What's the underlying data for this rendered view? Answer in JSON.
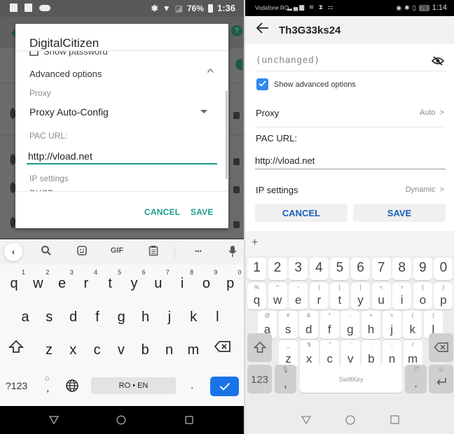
{
  "left": {
    "status_bar": {
      "battery": "76%",
      "time": "1:36",
      "left_icons": [
        "notes-icon",
        "image-icon",
        "cloud-icon"
      ],
      "right_icons": [
        "bluetooth-icon",
        "wifi-icon",
        "no-sim-icon",
        "battery-charging-icon"
      ]
    },
    "dialog": {
      "title": "DigitalCitizen",
      "show_password_label": "Show password",
      "show_password_checked": false,
      "advanced_options_label": "Advanced options",
      "proxy_label": "Proxy",
      "proxy_value": "Proxy Auto-Config",
      "pac_url_label": "PAC URL:",
      "pac_url_value": "http://vload.net",
      "ip_settings_label": "IP settings",
      "ip_settings_value_cut": "DHCP",
      "cancel_label": "CANCEL",
      "save_label": "SAVE",
      "accent_color": "#1a9e8a"
    },
    "keyboard": {
      "toolbar": {
        "back": "‹",
        "gif": "GIF",
        "more": "•••"
      },
      "row1": [
        {
          "k": "q",
          "n": "1"
        },
        {
          "k": "w",
          "n": "2"
        },
        {
          "k": "e",
          "n": "3"
        },
        {
          "k": "r",
          "n": "4"
        },
        {
          "k": "t",
          "n": "5"
        },
        {
          "k": "y",
          "n": "6"
        },
        {
          "k": "u",
          "n": "7"
        },
        {
          "k": "i",
          "n": "8"
        },
        {
          "k": "o",
          "n": "9"
        },
        {
          "k": "p",
          "n": "0"
        }
      ],
      "row2": [
        "a",
        "s",
        "d",
        "f",
        "g",
        "h",
        "j",
        "k",
        "l"
      ],
      "row3": [
        "z",
        "x",
        "c",
        "v",
        "b",
        "n",
        "m"
      ],
      "symbols_label": "?123",
      "comma_label": ",",
      "space_label": "RO • EN",
      "period_label": ".",
      "enter_color": "#1a73e8"
    }
  },
  "right": {
    "status_bar": {
      "carrier": "Vodafone RO",
      "battery": "79",
      "time": "1:14"
    },
    "app_bar": {
      "title": "Th3G33ks24"
    },
    "password_value": "(unchanged)",
    "show_advanced_label": "Show advanced options",
    "show_advanced_checked": true,
    "proxy_label": "Proxy",
    "proxy_value": "Auto",
    "pac_url_label": "PAC URL:",
    "pac_url_value": "http://vload.net",
    "ip_settings_label": "IP settings",
    "ip_settings_value": "Dynamic",
    "cancel_label": "CANCEL",
    "save_label": "SAVE",
    "accent_color": "#1a5fbf",
    "keyboard": {
      "brand": "SwiftKey",
      "numbers": [
        "1",
        "2",
        "3",
        "4",
        "5",
        "6",
        "7",
        "8",
        "9",
        "0"
      ],
      "row1": [
        {
          "k": "q",
          "s": "%"
        },
        {
          "k": "w",
          "s": "^"
        },
        {
          "k": "e",
          "s": "~"
        },
        {
          "k": "r",
          "s": "|"
        },
        {
          "k": "t",
          "s": "["
        },
        {
          "k": "y",
          "s": "]"
        },
        {
          "k": "u",
          "s": "<"
        },
        {
          "k": "i",
          "s": ">"
        },
        {
          "k": "o",
          "s": "{"
        },
        {
          "k": "p",
          "s": "}"
        }
      ],
      "row2": [
        {
          "k": "a",
          "s": "@"
        },
        {
          "k": "s",
          "s": "#"
        },
        {
          "k": "d",
          "s": "&"
        },
        {
          "k": "f",
          "s": "*"
        },
        {
          "k": "g",
          "s": "-"
        },
        {
          "k": "h",
          "s": "+"
        },
        {
          "k": "j",
          "s": "="
        },
        {
          "k": "k",
          "s": "("
        },
        {
          "k": "l",
          "s": ")"
        }
      ],
      "row3": [
        {
          "k": "z",
          "s": "_"
        },
        {
          "k": "x",
          "s": "$"
        },
        {
          "k": "c",
          "s": "\""
        },
        {
          "k": "v",
          "s": "'"
        },
        {
          "k": "b",
          "s": ":"
        },
        {
          "k": "n",
          "s": ";"
        },
        {
          "k": "m",
          "s": "/"
        }
      ],
      "numbers_key": "123",
      "comma_key": ",",
      "period_key": ".",
      "period_secondary": ",!?"
    }
  }
}
